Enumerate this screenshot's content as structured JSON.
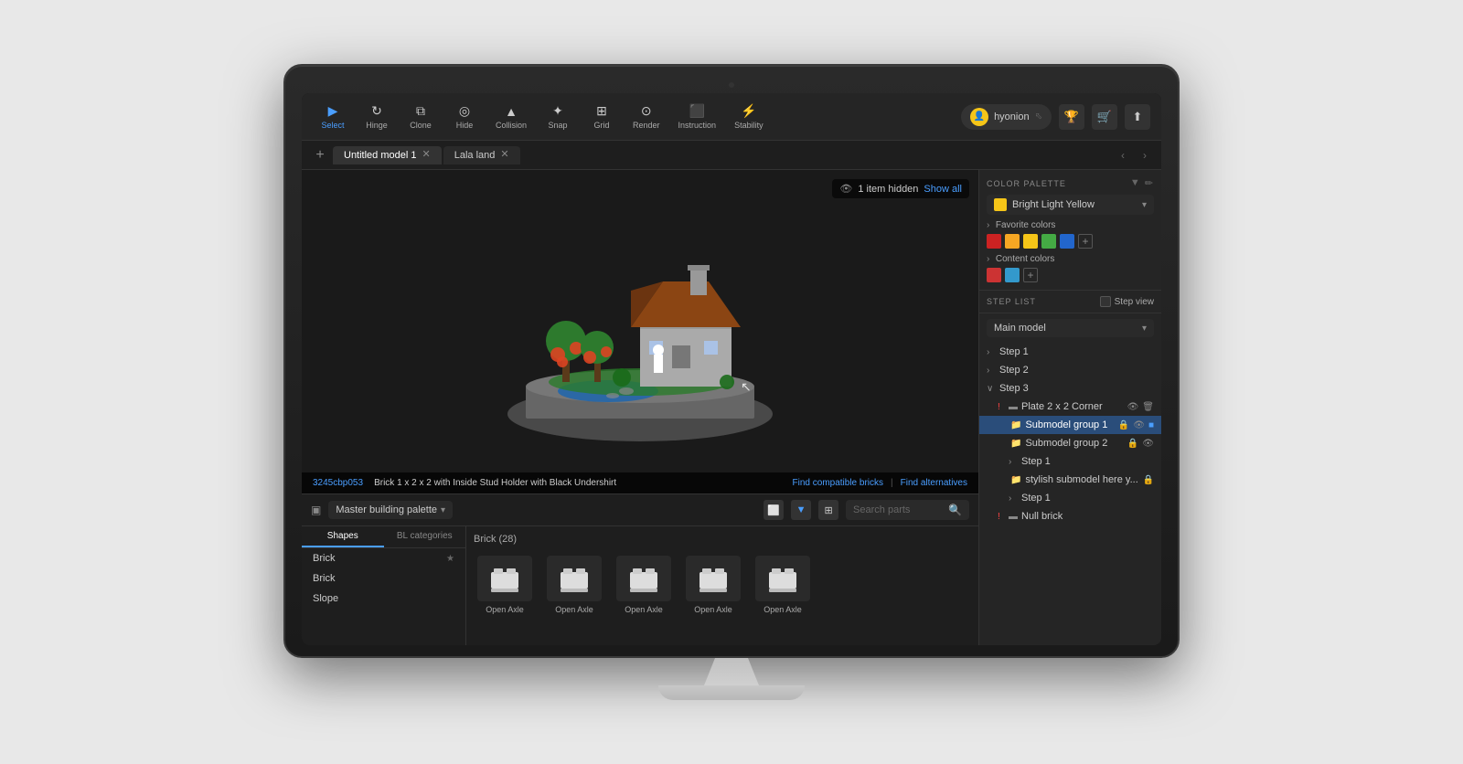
{
  "toolbar": {
    "items": [
      {
        "id": "select",
        "label": "Select",
        "icon": "▶",
        "active": true
      },
      {
        "id": "hinge",
        "label": "Hinge",
        "icon": "↻"
      },
      {
        "id": "clone",
        "label": "Clone",
        "icon": "⧉"
      },
      {
        "id": "hide",
        "label": "Hide",
        "icon": "◎"
      },
      {
        "id": "collision",
        "label": "Collision",
        "icon": "▲"
      },
      {
        "id": "snap",
        "label": "Snap",
        "icon": "✦"
      },
      {
        "id": "grid",
        "label": "Grid",
        "icon": "⊞"
      },
      {
        "id": "render",
        "label": "Render",
        "icon": "⊙"
      },
      {
        "id": "instruction",
        "label": "Instruction",
        "icon": "⬛"
      },
      {
        "id": "stability",
        "label": "Stability",
        "icon": "⚡"
      }
    ],
    "user": {
      "name": "hyonion",
      "avatar_color": "#f5c518"
    }
  },
  "tabs": [
    {
      "id": "tab1",
      "label": "Untitled model 1",
      "active": true
    },
    {
      "id": "tab2",
      "label": "Lala land",
      "active": false
    }
  ],
  "viewport": {
    "hidden_notice": "1 item hidden",
    "show_all": "Show all",
    "part_id": "3245cbp053",
    "part_name": "Brick 1 x 2 x 2 with Inside Stud Holder with Black Undershirt",
    "find_compatible": "Find compatible bricks",
    "find_alternatives": "Find alternatives"
  },
  "color_palette": {
    "title": "COLOR PALETTE",
    "selected_color": "Bright Light Yellow",
    "selected_color_hex": "#f5c518",
    "favorite_colors_label": "Favorite colors",
    "favorites": [
      {
        "hex": "#cc2222"
      },
      {
        "hex": "#f5a623"
      },
      {
        "hex": "#f5c518"
      },
      {
        "hex": "#44aa44"
      },
      {
        "hex": "#2266cc"
      }
    ],
    "content_colors_label": "Content colors",
    "content": [
      {
        "hex": "#cc3333"
      },
      {
        "hex": "#3399cc"
      }
    ]
  },
  "step_list": {
    "title": "STEP LIST",
    "step_view_label": "Step view",
    "main_model_label": "Main model",
    "items": [
      {
        "id": "step1",
        "label": "Step 1",
        "indent": 0,
        "expandable": true
      },
      {
        "id": "step2",
        "label": "Step 2",
        "indent": 0,
        "expandable": true
      },
      {
        "id": "step3",
        "label": "Step 3",
        "indent": 0,
        "expanded": true
      },
      {
        "id": "plate",
        "label": "Plate 2 x 2 Corner",
        "indent": 1,
        "warning": true
      },
      {
        "id": "submodel1",
        "label": "Submodel group 1",
        "indent": 1,
        "active": true,
        "folder": true
      },
      {
        "id": "submodel2",
        "label": "Submodel group 2",
        "indent": 1,
        "folder": true
      },
      {
        "id": "substep1",
        "label": "Step 1",
        "indent": 2,
        "expandable": true
      },
      {
        "id": "stylish",
        "label": "stylish submodel here y...",
        "indent": 1,
        "folder": true
      },
      {
        "id": "substep1b",
        "label": "Step 1",
        "indent": 2,
        "expandable": true
      },
      {
        "id": "nullbrick",
        "label": "Null brick",
        "indent": 1,
        "warning": true
      }
    ]
  },
  "parts_panel": {
    "palette_label": "Master building palette",
    "search_placeholder": "Search parts",
    "tabs": [
      "Shapes",
      "BL categories"
    ],
    "active_tab": "Shapes",
    "categories": [
      "Brick",
      "Brick",
      "Slope"
    ],
    "grid_title": "Brick (28)",
    "bricks": [
      {
        "label": "Open Axle"
      },
      {
        "label": "Open Axle"
      },
      {
        "label": "Open Axle"
      },
      {
        "label": "Open Axle"
      },
      {
        "label": "Open Axle"
      }
    ]
  }
}
